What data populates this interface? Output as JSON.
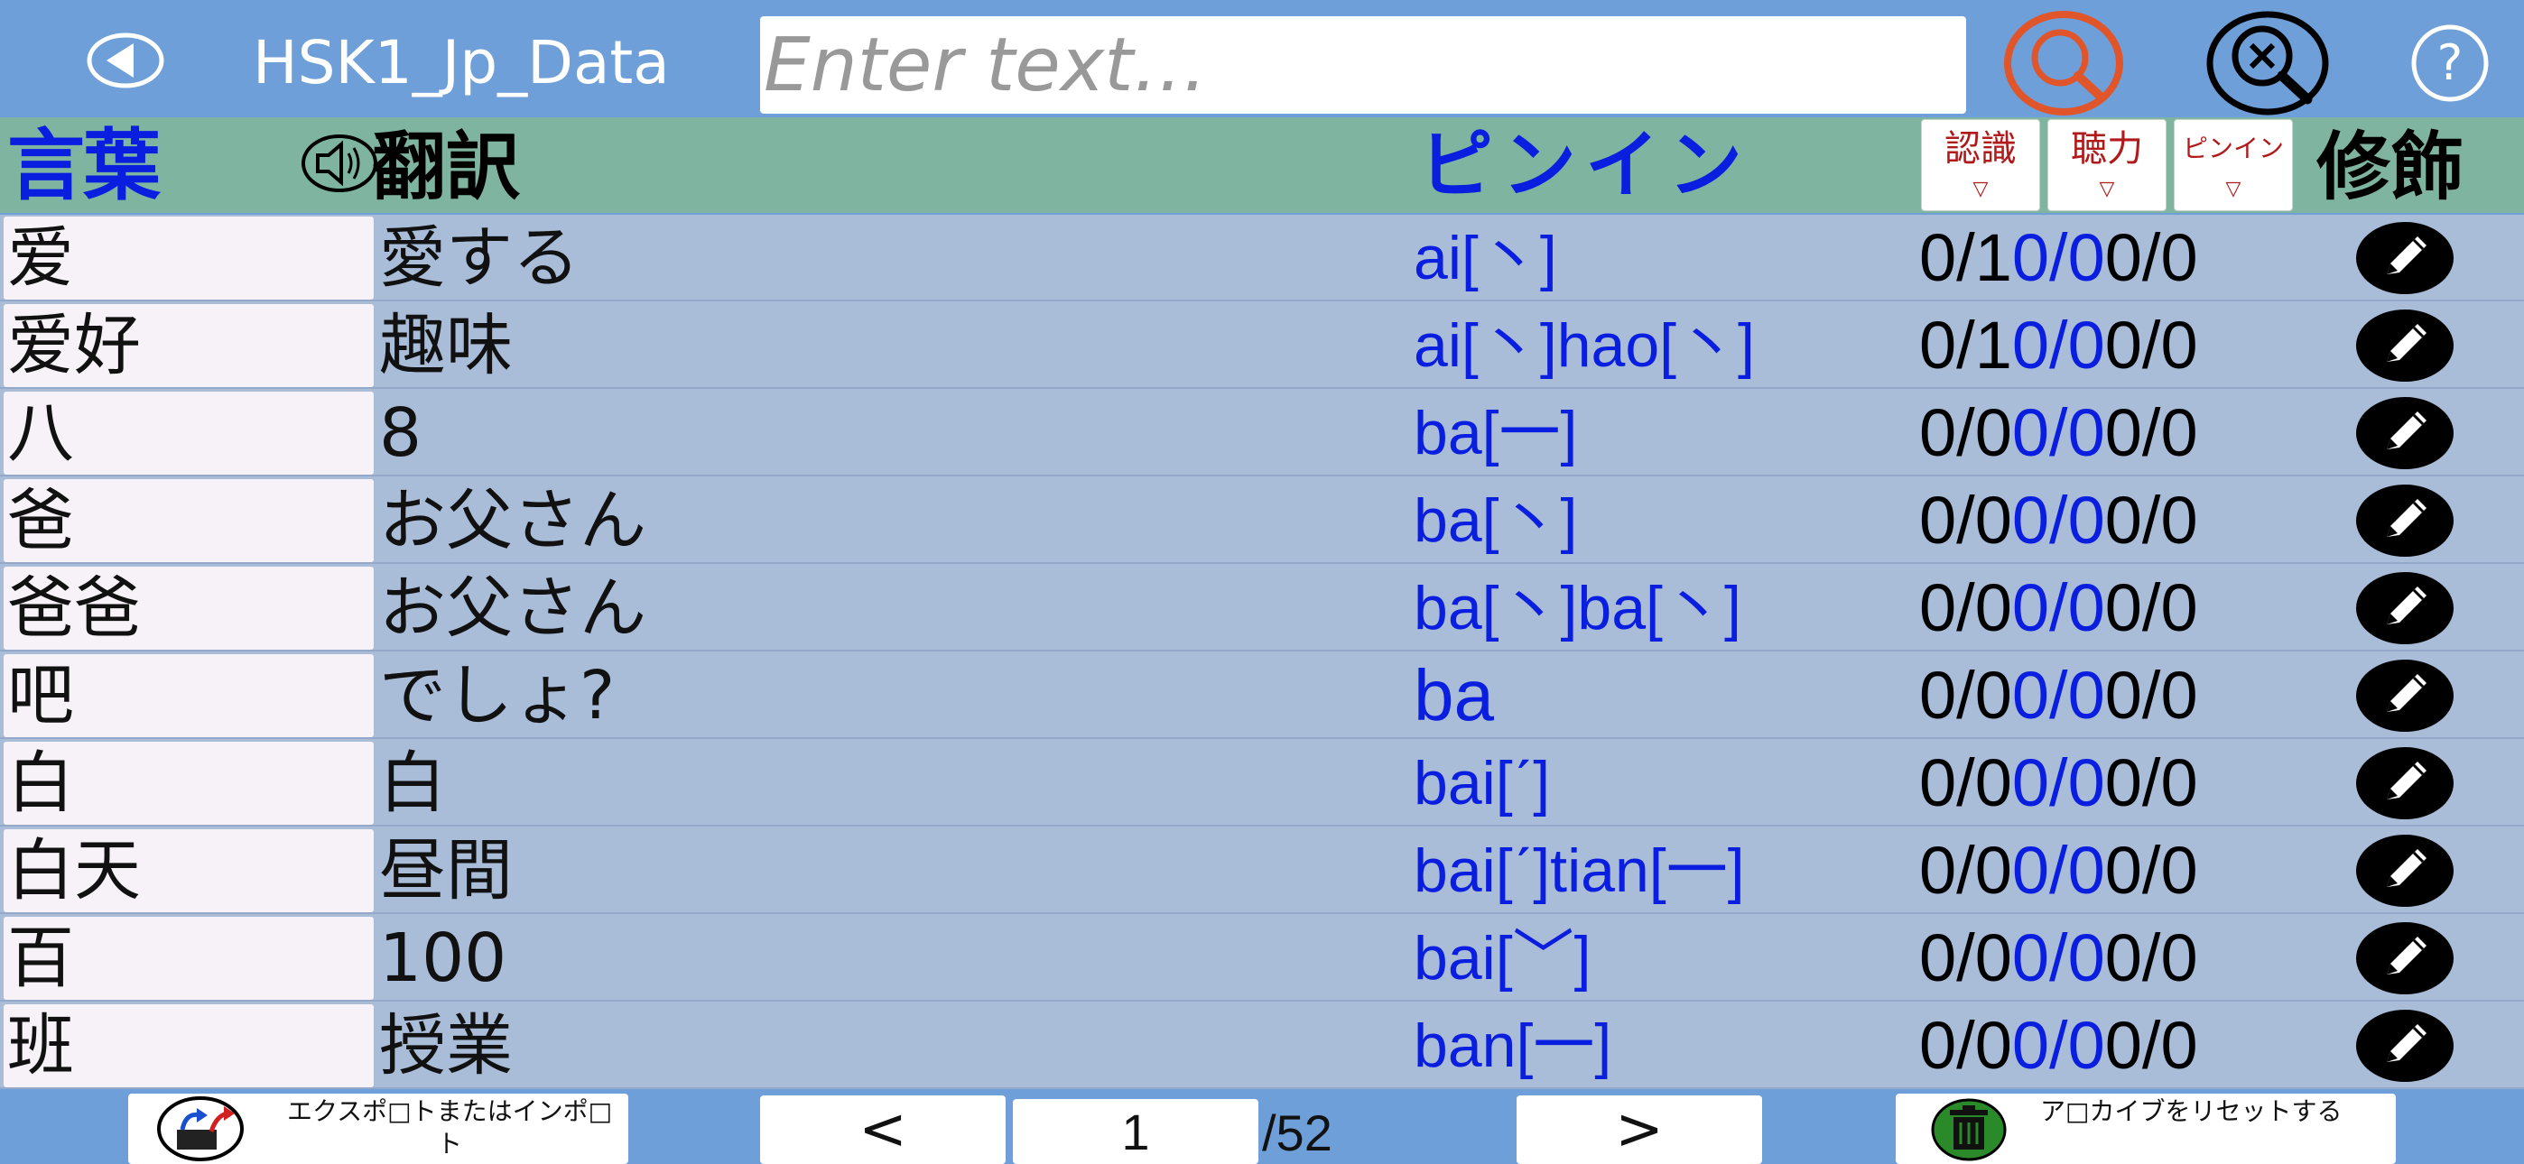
{
  "app": {
    "title": "HSK1_Jp_Data",
    "search_placeholder": "Enter text…"
  },
  "colors": {
    "topbar": "#6f9fd8",
    "header": "#7fb5a0",
    "rows": "#a9bcd8",
    "accent_blue": "#0a1ee0",
    "accent_red": "#b01a1a",
    "search_icon": "#e0552a"
  },
  "icons": {
    "back": "back-arrow-icon",
    "search": "search-icon",
    "clear_search": "clear-search-icon",
    "help": "help-icon",
    "speaker": "speaker-icon",
    "edit": "pencil-icon",
    "export": "export-import-icon",
    "reset": "trash-icon"
  },
  "header": {
    "word": "言葉",
    "translation": "翻訳",
    "pinyin": "ピンイン",
    "sort_recognition": "認識",
    "sort_listening": "聴力",
    "sort_pinyin": "ピンイン",
    "sort_arrow": "▽",
    "edit": "修飾"
  },
  "rows": [
    {
      "word": "爱",
      "translation": "愛する",
      "pinyin": "ai[丶]",
      "s1": "0/1",
      "s2": "0/0",
      "s3": "0/0"
    },
    {
      "word": "爱好",
      "translation": "趣味",
      "pinyin": "ai[丶]hao[丶]",
      "s1": "0/1",
      "s2": "0/0",
      "s3": "0/0"
    },
    {
      "word": "八",
      "translation": "8",
      "pinyin": "ba[一]",
      "s1": "0/0",
      "s2": "0/0",
      "s3": "0/0"
    },
    {
      "word": "爸",
      "translation": "お父さん",
      "pinyin": "ba[丶]",
      "s1": "0/0",
      "s2": "0/0",
      "s3": "0/0"
    },
    {
      "word": "爸爸",
      "translation": "お父さん",
      "pinyin": "ba[丶]ba[丶]",
      "s1": "0/0",
      "s2": "0/0",
      "s3": "0/0"
    },
    {
      "word": "吧",
      "translation": "でしょ?",
      "pinyin": "ba",
      "s1": "0/0",
      "s2": "0/0",
      "s3": "0/0"
    },
    {
      "word": "白",
      "translation": "白",
      "pinyin": "bai[ˊ]",
      "s1": "0/0",
      "s2": "0/0",
      "s3": "0/0"
    },
    {
      "word": "白天",
      "translation": "昼間",
      "pinyin": "bai[ˊ]tian[一]",
      "s1": "0/0",
      "s2": "0/0",
      "s3": "0/0"
    },
    {
      "word": "百",
      "translation": "100",
      "pinyin": "bai[﹀]",
      "s1": "0/0",
      "s2": "0/0",
      "s3": "0/0"
    },
    {
      "word": "班",
      "translation": "授業",
      "pinyin": "ban[一]",
      "s1": "0/0",
      "s2": "0/0",
      "s3": "0/0"
    }
  ],
  "footer": {
    "export_label": "エクスポ□トまたはインポ□ト",
    "prev": "<",
    "page": "1",
    "total": "/52",
    "next": ">",
    "reset_label": "ア□カイブをリセットする"
  }
}
